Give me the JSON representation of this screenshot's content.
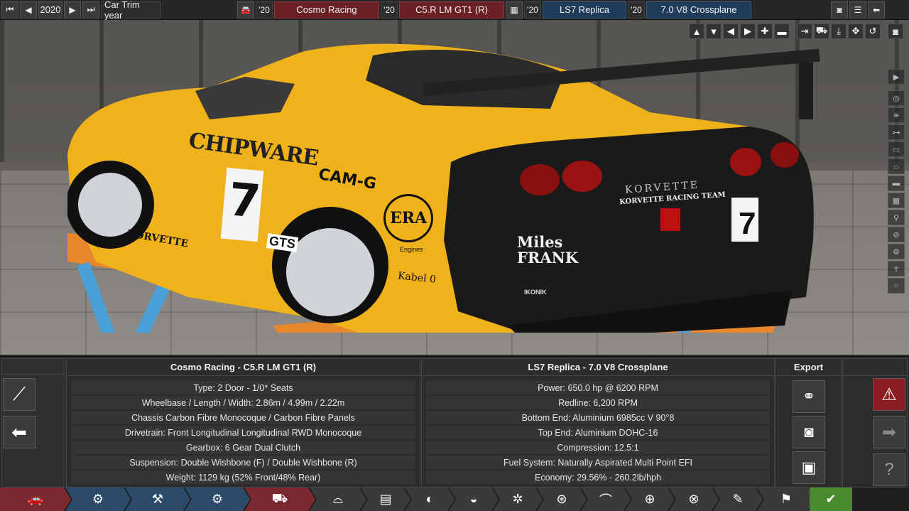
{
  "topbar": {
    "year": "2020",
    "trim_label": "Car Trim year",
    "model_year": "'20",
    "model_name": "Cosmo Racing",
    "trim_year": "'20",
    "trim_name": "C5.R LM GT1 (R)",
    "engine_family_year": "'20",
    "engine_family": "LS7 Replica",
    "variant_year": "'20",
    "variant_name": "7.0 V8 Crossplane"
  },
  "car": {
    "livery_sponsor": "CHIPWARE",
    "race_number": "7",
    "sponsor_2": "CAM-G",
    "sponsor_3": "ERA",
    "sponsor_3_sub": "Engines",
    "class_label": "GTS",
    "brand_side": "KORVETTE",
    "brand_rear": "KORVETTE",
    "team_name": "KORVETTE RACING TEAM",
    "driver": "Miles FRANK",
    "cable_sponsor": "Kabel 0",
    "exhaust_brand": "IKONIK"
  },
  "trim_panel": {
    "title": "Cosmo Racing - C5.R LM GT1 (R)",
    "rows": [
      "Type: 2 Door - 1/0* Seats",
      "Wheelbase / Length / Width: 2.86m / 4.99m / 2.22m",
      "Chassis Carbon Fibre Monocoque / Carbon Fibre Panels",
      "Drivetrain: Front Longitudinal Longitudinal RWD Monocoque",
      "Gearbox: 6 Gear Dual Clutch",
      "Suspension: Double Wishbone (F) / Double Wishbone (R)",
      "Weight: 1129 kg (52% Front/48% Rear)"
    ]
  },
  "engine_panel": {
    "title": "LS7 Replica - 7.0 V8 Crossplane",
    "rows": [
      "Power: 650.0 hp @ 6200 RPM",
      "Redline:  6,200 RPM",
      "Bottom End: Aluminium 6985cc V 90°8",
      "Top End: Aluminium DOHC-16",
      "Compression: 12.5:1",
      "Fuel System: Naturally Aspirated Multi Point EFI",
      "Economy: 29.56% - 260.2lb/hph"
    ]
  },
  "export": {
    "title": "Export"
  },
  "colors": {
    "red_accent": "#7a2a2e",
    "blue_accent": "#2c4a6a",
    "confirm_green": "#4a8a2e",
    "car_yellow": "#f0b21a"
  }
}
